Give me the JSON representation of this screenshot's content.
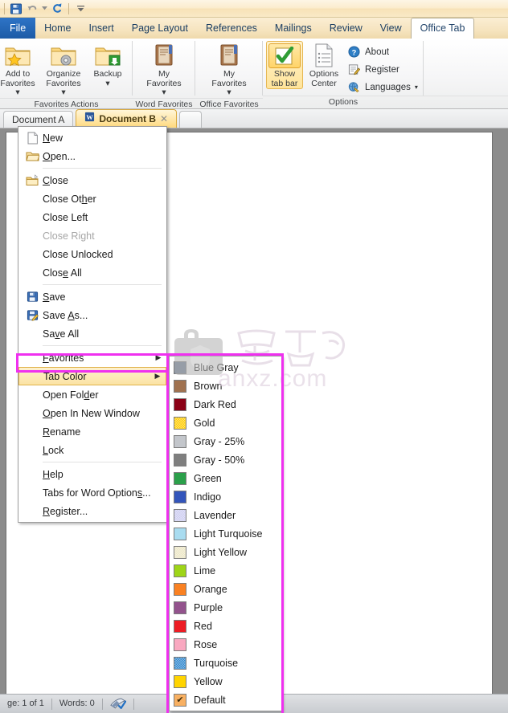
{
  "quick_access": {
    "items": [
      {
        "name": "save-icon",
        "label": "Save"
      },
      {
        "name": "undo-icon",
        "label": "Undo"
      },
      {
        "name": "redo-icon",
        "label": "Redo"
      },
      {
        "name": "customize-quick-access-icon",
        "label": "Customize Quick Access Toolbar"
      }
    ]
  },
  "ribbon": {
    "tabs": [
      {
        "label": "File",
        "state": "file"
      },
      {
        "label": "Home",
        "state": "normal"
      },
      {
        "label": "Insert",
        "state": "normal"
      },
      {
        "label": "Page Layout",
        "state": "normal"
      },
      {
        "label": "References",
        "state": "normal"
      },
      {
        "label": "Mailings",
        "state": "normal"
      },
      {
        "label": "Review",
        "state": "normal"
      },
      {
        "label": "View",
        "state": "normal"
      },
      {
        "label": "Office Tab",
        "state": "active"
      }
    ],
    "groups": [
      {
        "label": "Favorites Actions",
        "buttons": [
          {
            "caption": "Add to\nFavorites",
            "icon": "folder-star-icon",
            "dropdown": true
          },
          {
            "caption": "Organize\nFavorites",
            "icon": "folder-gear-icon",
            "dropdown": true
          },
          {
            "caption": "Backup",
            "icon": "folder-export-icon",
            "dropdown": true
          }
        ]
      },
      {
        "label": "Word Favorites",
        "buttons": [
          {
            "caption": "My\nFavorites",
            "icon": "book-icon",
            "dropdown": true
          }
        ]
      },
      {
        "label": "Office Favorites",
        "buttons": [
          {
            "caption": "My\nFavorites",
            "icon": "book-icon",
            "dropdown": true
          }
        ]
      },
      {
        "label": "Options",
        "buttons": [
          {
            "caption": "Show\ntab bar",
            "icon": "green-check-icon",
            "dropdown": false,
            "checked": true
          },
          {
            "caption": "Options\nCenter",
            "icon": "document-list-icon",
            "dropdown": false
          }
        ],
        "small_buttons": [
          {
            "label": "About",
            "icon": "help-question-icon",
            "dropdown": false
          },
          {
            "label": "Register",
            "icon": "register-pencil-icon",
            "dropdown": false
          },
          {
            "label": "Languages",
            "icon": "languages-globe-icon",
            "dropdown": true
          }
        ]
      }
    ]
  },
  "document_tabs": {
    "tabs": [
      {
        "label": "Document A",
        "active": false,
        "has_icon": false,
        "has_close": false
      },
      {
        "label": "Document B",
        "active": true,
        "has_icon": true,
        "has_close": true,
        "close_label": "✕"
      }
    ],
    "new_tab_label": ""
  },
  "context_menu": {
    "items": [
      {
        "label": "New",
        "accel": "N",
        "icon": "new-document-icon",
        "type": "item"
      },
      {
        "label": "Open...",
        "accel": "O",
        "icon": "open-folder-icon",
        "type": "item"
      },
      {
        "type": "separator"
      },
      {
        "label": "Close",
        "accel": "C",
        "icon": "close-folder-icon",
        "type": "item"
      },
      {
        "label": "Close Other",
        "accel": "h",
        "icon": null,
        "type": "item"
      },
      {
        "label": "Close Left",
        "accel": null,
        "icon": null,
        "type": "item"
      },
      {
        "label": "Close Right",
        "accel": null,
        "icon": null,
        "type": "item",
        "disabled": true
      },
      {
        "label": "Close Unlocked",
        "accel": null,
        "icon": null,
        "type": "item"
      },
      {
        "label": "Close All",
        "accel": "e",
        "icon": null,
        "type": "item"
      },
      {
        "type": "separator"
      },
      {
        "label": "Save",
        "accel": "S",
        "icon": "save-floppy-icon",
        "type": "item"
      },
      {
        "label": "Save As...",
        "accel": "A",
        "icon": "save-as-icon",
        "type": "item"
      },
      {
        "label": "Save All",
        "accel": "v",
        "icon": null,
        "type": "item"
      },
      {
        "type": "separator"
      },
      {
        "label": "Favorites",
        "accel": "F",
        "icon": null,
        "type": "item",
        "submenu": true
      },
      {
        "label": "Tab Color",
        "accel": null,
        "icon": null,
        "type": "item",
        "submenu": true,
        "highlighted": true
      },
      {
        "label": "Open Folder",
        "accel": "d",
        "icon": null,
        "type": "item"
      },
      {
        "label": "Open In New Window",
        "accel": "O",
        "icon": null,
        "type": "item"
      },
      {
        "label": "Rename",
        "accel": "R",
        "icon": null,
        "type": "item"
      },
      {
        "label": "Lock",
        "accel": "L",
        "icon": null,
        "type": "item"
      },
      {
        "type": "separator"
      },
      {
        "label": "Help",
        "accel": "H",
        "icon": null,
        "type": "item"
      },
      {
        "label": "Tabs for Word Options...",
        "accel": "s",
        "icon": null,
        "type": "item"
      },
      {
        "label": "Register...",
        "accel": "R",
        "icon": null,
        "type": "item"
      }
    ],
    "submenu_arrow": "▶"
  },
  "color_submenu": {
    "items": [
      {
        "label": "Blue Gray",
        "color": "#6b7c94",
        "pattern": false,
        "checked": false
      },
      {
        "label": "Brown",
        "color": "#a07250",
        "pattern": false,
        "checked": false
      },
      {
        "label": "Dark Red",
        "color": "#8b0016",
        "pattern": false,
        "checked": false
      },
      {
        "label": "Gold",
        "color": "#ffcc00",
        "pattern": true,
        "checked": false
      },
      {
        "label": "Gray - 25%",
        "color": "#c3c6cb",
        "pattern": false,
        "checked": false
      },
      {
        "label": "Gray - 50%",
        "color": "#7f7f7f",
        "pattern": false,
        "checked": false
      },
      {
        "label": "Green",
        "color": "#2ba04a",
        "pattern": false,
        "checked": false
      },
      {
        "label": "Indigo",
        "color": "#3355bb",
        "pattern": false,
        "checked": false
      },
      {
        "label": "Lavender",
        "color": "#ccccf0",
        "pattern": true,
        "checked": false
      },
      {
        "label": "Light Turquoise",
        "color": "#a9dcf0",
        "pattern": false,
        "checked": false
      },
      {
        "label": "Light Yellow",
        "color": "#ece6c4",
        "pattern": true,
        "checked": false
      },
      {
        "label": "Lime",
        "color": "#9ed517",
        "pattern": false,
        "checked": false
      },
      {
        "label": "Orange",
        "color": "#fa8122",
        "pattern": false,
        "checked": false
      },
      {
        "label": "Purple",
        "color": "#93538d",
        "pattern": false,
        "checked": false
      },
      {
        "label": "Red",
        "color": "#ed1c24",
        "pattern": false,
        "checked": false
      },
      {
        "label": "Rose",
        "color": "#f9a8c0",
        "pattern": false,
        "checked": false
      },
      {
        "label": "Turquoise",
        "color": "#2f86cd",
        "pattern": true,
        "checked": false
      },
      {
        "label": "Yellow",
        "color": "#ffd400",
        "pattern": false,
        "checked": false
      },
      {
        "label": "Default",
        "color": "#f8b062",
        "pattern": false,
        "checked": true,
        "check_glyph": "✔"
      }
    ]
  },
  "status_bar": {
    "page_label": "ge: 1 of 1",
    "words_label": "Words: 0",
    "proofing_icon": "proofing-errors-icon"
  },
  "watermark": {
    "text": "anxz.com",
    "cjk": "安下载"
  },
  "annotations": {
    "accent_color": "#ef30ef"
  }
}
